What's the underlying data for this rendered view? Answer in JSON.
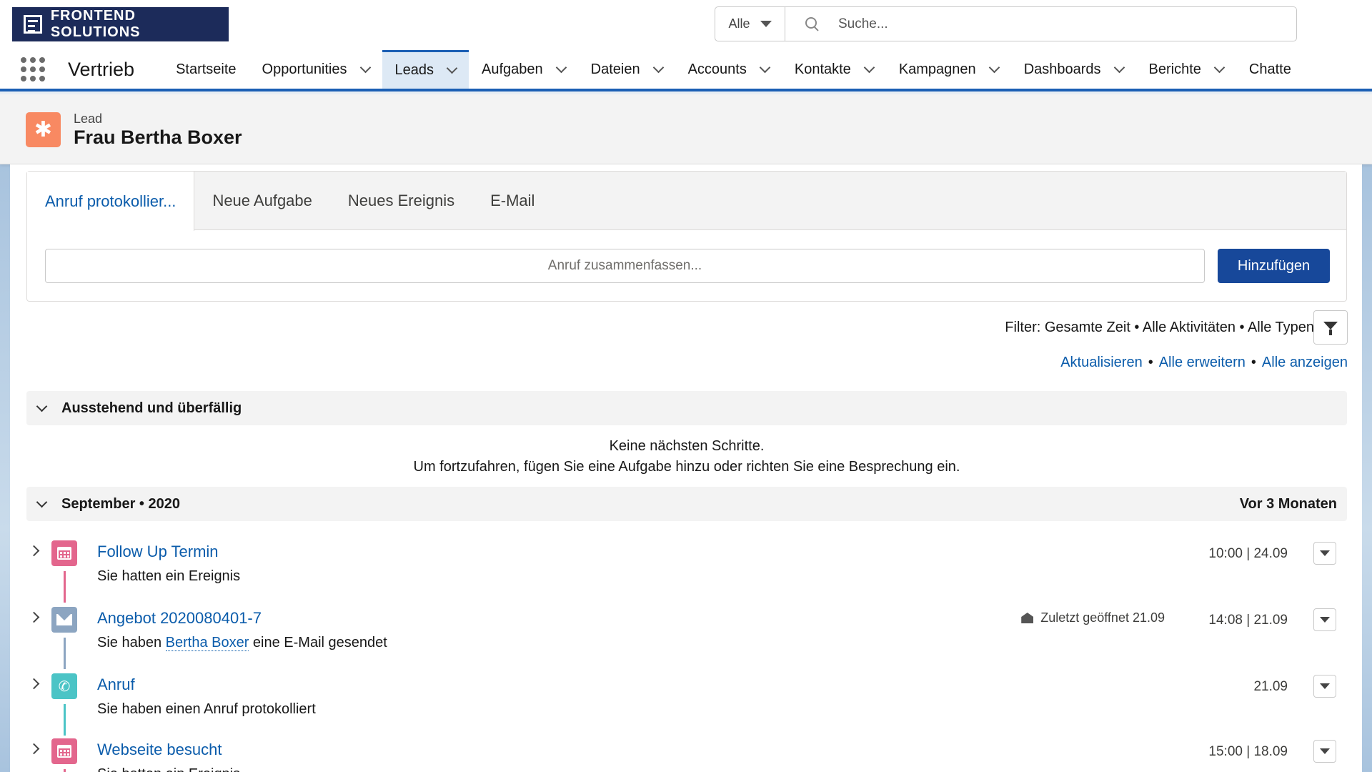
{
  "brand": {
    "logo_text": "FRONTEND SOLUTIONS"
  },
  "search": {
    "scope": "Alle",
    "placeholder": "Suche..."
  },
  "nav": {
    "app_name": "Vertrieb",
    "items": [
      {
        "label": "Startseite",
        "dropdown": false
      },
      {
        "label": "Opportunities",
        "dropdown": true
      },
      {
        "label": "Leads",
        "dropdown": true,
        "active": true
      },
      {
        "label": "Aufgaben",
        "dropdown": true
      },
      {
        "label": "Dateien",
        "dropdown": true
      },
      {
        "label": "Accounts",
        "dropdown": true
      },
      {
        "label": "Kontakte",
        "dropdown": true
      },
      {
        "label": "Kampagnen",
        "dropdown": true
      },
      {
        "label": "Dashboards",
        "dropdown": true
      },
      {
        "label": "Berichte",
        "dropdown": true
      },
      {
        "label": "Chatte",
        "dropdown": false
      }
    ]
  },
  "record": {
    "type": "Lead",
    "name": "Frau Bertha Boxer",
    "icon": "lead-icon",
    "icon_color": "#f88962"
  },
  "composer": {
    "tabs": [
      "Anruf protokollier...",
      "Neue Aufgabe",
      "Neues Ereignis",
      "E-Mail"
    ],
    "active_tab": 0,
    "input_placeholder": "Anruf zusammenfassen...",
    "add_label": "Hinzufügen"
  },
  "filter": {
    "text": "Filter: Gesamte Zeit • Alle Aktivitäten • Alle Typen",
    "links": [
      "Aktualisieren",
      "Alle erweitern",
      "Alle anzeigen"
    ],
    "separator": "•"
  },
  "sections": {
    "upcoming": {
      "title": "Ausstehend und überfällig",
      "empty_line1": "Keine nächsten Schritte.",
      "empty_line2": "Um fortzufahren, fügen Sie eine Aufgabe hinzu oder richten Sie eine Besprechung ein."
    },
    "month": {
      "title": "September • 2020",
      "relative": "Vor 3 Monaten"
    }
  },
  "timeline": [
    {
      "title": "Follow Up Termin",
      "subtitle": "Sie hatten ein Ereignis",
      "time": "10:00 | 24.09",
      "icon": "calendar-icon",
      "color": "#e3668d"
    },
    {
      "title": "Angebot 2020080401-7",
      "subtitle_pre": "Sie haben ",
      "subtitle_link": "Bertha Boxer",
      "subtitle_post": " eine E-Mail gesendet",
      "opened": "Zuletzt geöffnet 21.09",
      "time": "14:08 | 21.09",
      "icon": "email-icon",
      "color": "#8ca5c1"
    },
    {
      "title": "Anruf",
      "subtitle": "Sie haben einen Anruf protokolliert",
      "time": "21.09",
      "icon": "phone-icon",
      "color": "#4bc4c6"
    },
    {
      "title": "Webseite besucht",
      "subtitle": "Sie hatten ein Ereignis",
      "time": "15:00 | 18.09",
      "icon": "calendar-icon",
      "color": "#e3668d"
    }
  ]
}
